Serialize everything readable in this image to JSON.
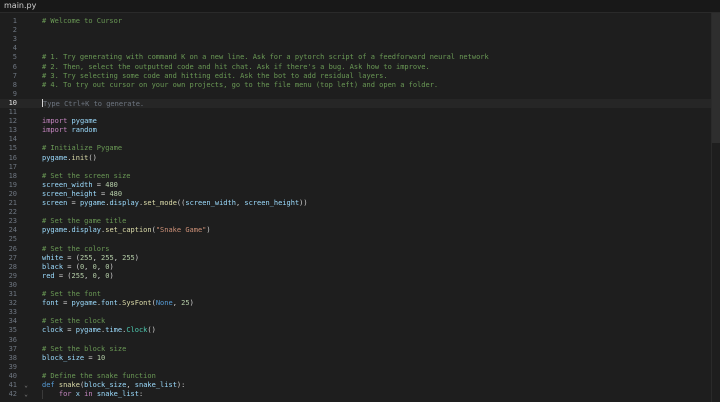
{
  "window": {
    "tab_title": "main.py"
  },
  "editor": {
    "current_line": 10,
    "lines": [
      {
        "n": "1",
        "tokens": [
          {
            "t": "# Welcome to Cursor",
            "c": "comment"
          }
        ]
      },
      {
        "n": "2",
        "tokens": []
      },
      {
        "n": "3",
        "tokens": []
      },
      {
        "n": "4",
        "tokens": []
      },
      {
        "n": "5",
        "tokens": [
          {
            "t": "# 1. Try generating with command K on a new line. Ask for a pytorch script of a feedforward neural network",
            "c": "comment"
          }
        ]
      },
      {
        "n": "6",
        "tokens": [
          {
            "t": "# 2. Then, select the outputted code and hit chat. Ask if there's a bug. Ask how to improve.",
            "c": "comment"
          }
        ]
      },
      {
        "n": "7",
        "tokens": [
          {
            "t": "# 3. Try selecting some code and hitting edit. Ask the bot to add residual layers.",
            "c": "comment"
          }
        ]
      },
      {
        "n": "8",
        "tokens": [
          {
            "t": "# 4. To try out cursor on your own projects, go to the file menu (top left) and open a folder.",
            "c": "comment"
          }
        ]
      },
      {
        "n": "9",
        "tokens": []
      },
      {
        "n": "10",
        "tokens": [
          {
            "t": "Type Ctrl+K to generate.",
            "c": "placeholder"
          }
        ],
        "cursor": true
      },
      {
        "n": "11",
        "tokens": []
      },
      {
        "n": "12",
        "tokens": [
          {
            "t": "import",
            "c": "keyword"
          },
          {
            "t": " ",
            "c": "plain"
          },
          {
            "t": "pygame",
            "c": "var"
          }
        ]
      },
      {
        "n": "13",
        "tokens": [
          {
            "t": "import",
            "c": "keyword"
          },
          {
            "t": " ",
            "c": "plain"
          },
          {
            "t": "random",
            "c": "var"
          }
        ]
      },
      {
        "n": "14",
        "tokens": []
      },
      {
        "n": "15",
        "tokens": [
          {
            "t": "# Initialize Pygame",
            "c": "comment"
          }
        ]
      },
      {
        "n": "16",
        "tokens": [
          {
            "t": "pygame",
            "c": "var"
          },
          {
            "t": ".",
            "c": "plain"
          },
          {
            "t": "init",
            "c": "func"
          },
          {
            "t": "()",
            "c": "paren"
          }
        ]
      },
      {
        "n": "17",
        "tokens": []
      },
      {
        "n": "18",
        "tokens": [
          {
            "t": "# Set the screen size",
            "c": "comment"
          }
        ]
      },
      {
        "n": "19",
        "tokens": [
          {
            "t": "screen_width",
            "c": "var"
          },
          {
            "t": " = ",
            "c": "plain"
          },
          {
            "t": "480",
            "c": "num"
          }
        ]
      },
      {
        "n": "20",
        "tokens": [
          {
            "t": "screen_height",
            "c": "var"
          },
          {
            "t": " = ",
            "c": "plain"
          },
          {
            "t": "480",
            "c": "num"
          }
        ]
      },
      {
        "n": "21",
        "tokens": [
          {
            "t": "screen",
            "c": "var"
          },
          {
            "t": " = ",
            "c": "plain"
          },
          {
            "t": "pygame",
            "c": "var"
          },
          {
            "t": ".",
            "c": "plain"
          },
          {
            "t": "display",
            "c": "var"
          },
          {
            "t": ".",
            "c": "plain"
          },
          {
            "t": "set_mode",
            "c": "func"
          },
          {
            "t": "((",
            "c": "paren"
          },
          {
            "t": "screen_width",
            "c": "var"
          },
          {
            "t": ", ",
            "c": "plain"
          },
          {
            "t": "screen_height",
            "c": "var"
          },
          {
            "t": "))",
            "c": "paren"
          }
        ]
      },
      {
        "n": "22",
        "tokens": []
      },
      {
        "n": "23",
        "tokens": [
          {
            "t": "# Set the game title",
            "c": "comment"
          }
        ]
      },
      {
        "n": "24",
        "tokens": [
          {
            "t": "pygame",
            "c": "var"
          },
          {
            "t": ".",
            "c": "plain"
          },
          {
            "t": "display",
            "c": "var"
          },
          {
            "t": ".",
            "c": "plain"
          },
          {
            "t": "set_caption",
            "c": "func"
          },
          {
            "t": "(",
            "c": "paren"
          },
          {
            "t": "\"Snake Game\"",
            "c": "str"
          },
          {
            "t": ")",
            "c": "paren"
          }
        ]
      },
      {
        "n": "25",
        "tokens": []
      },
      {
        "n": "26",
        "tokens": [
          {
            "t": "# Set the colors",
            "c": "comment"
          }
        ]
      },
      {
        "n": "27",
        "tokens": [
          {
            "t": "white",
            "c": "var"
          },
          {
            "t": " = (",
            "c": "plain"
          },
          {
            "t": "255",
            "c": "num"
          },
          {
            "t": ", ",
            "c": "plain"
          },
          {
            "t": "255",
            "c": "num"
          },
          {
            "t": ", ",
            "c": "plain"
          },
          {
            "t": "255",
            "c": "num"
          },
          {
            "t": ")",
            "c": "plain"
          }
        ]
      },
      {
        "n": "28",
        "tokens": [
          {
            "t": "black",
            "c": "var"
          },
          {
            "t": " = (",
            "c": "plain"
          },
          {
            "t": "0",
            "c": "num"
          },
          {
            "t": ", ",
            "c": "plain"
          },
          {
            "t": "0",
            "c": "num"
          },
          {
            "t": ", ",
            "c": "plain"
          },
          {
            "t": "0",
            "c": "num"
          },
          {
            "t": ")",
            "c": "plain"
          }
        ]
      },
      {
        "n": "29",
        "tokens": [
          {
            "t": "red",
            "c": "var"
          },
          {
            "t": " = (",
            "c": "plain"
          },
          {
            "t": "255",
            "c": "num"
          },
          {
            "t": ", ",
            "c": "plain"
          },
          {
            "t": "0",
            "c": "num"
          },
          {
            "t": ", ",
            "c": "plain"
          },
          {
            "t": "0",
            "c": "num"
          },
          {
            "t": ")",
            "c": "plain"
          }
        ]
      },
      {
        "n": "30",
        "tokens": []
      },
      {
        "n": "31",
        "tokens": [
          {
            "t": "# Set the font",
            "c": "comment"
          }
        ]
      },
      {
        "n": "32",
        "tokens": [
          {
            "t": "font",
            "c": "var"
          },
          {
            "t": " = ",
            "c": "plain"
          },
          {
            "t": "pygame",
            "c": "var"
          },
          {
            "t": ".",
            "c": "plain"
          },
          {
            "t": "font",
            "c": "var"
          },
          {
            "t": ".",
            "c": "plain"
          },
          {
            "t": "SysFont",
            "c": "func"
          },
          {
            "t": "(",
            "c": "paren"
          },
          {
            "t": "None",
            "c": "def"
          },
          {
            "t": ", ",
            "c": "plain"
          },
          {
            "t": "25",
            "c": "num"
          },
          {
            "t": ")",
            "c": "paren"
          }
        ]
      },
      {
        "n": "33",
        "tokens": []
      },
      {
        "n": "34",
        "tokens": [
          {
            "t": "# Set the clock",
            "c": "comment"
          }
        ]
      },
      {
        "n": "35",
        "tokens": [
          {
            "t": "clock",
            "c": "var"
          },
          {
            "t": " = ",
            "c": "plain"
          },
          {
            "t": "pygame",
            "c": "var"
          },
          {
            "t": ".",
            "c": "plain"
          },
          {
            "t": "time",
            "c": "var"
          },
          {
            "t": ".",
            "c": "plain"
          },
          {
            "t": "Clock",
            "c": "builtin"
          },
          {
            "t": "()",
            "c": "paren"
          }
        ]
      },
      {
        "n": "36",
        "tokens": []
      },
      {
        "n": "37",
        "tokens": [
          {
            "t": "# Set the block size",
            "c": "comment"
          }
        ]
      },
      {
        "n": "38",
        "tokens": [
          {
            "t": "block_size",
            "c": "var"
          },
          {
            "t": " = ",
            "c": "plain"
          },
          {
            "t": "10",
            "c": "num"
          }
        ]
      },
      {
        "n": "39",
        "tokens": []
      },
      {
        "n": "40",
        "tokens": [
          {
            "t": "# Define the snake function",
            "c": "comment"
          }
        ]
      },
      {
        "n": "41",
        "tokens": [
          {
            "t": "def",
            "c": "def"
          },
          {
            "t": " ",
            "c": "plain"
          },
          {
            "t": "snake",
            "c": "func"
          },
          {
            "t": "(",
            "c": "paren"
          },
          {
            "t": "block_size",
            "c": "var"
          },
          {
            "t": ", ",
            "c": "plain"
          },
          {
            "t": "snake_list",
            "c": "var"
          },
          {
            "t": "):",
            "c": "paren"
          }
        ],
        "fold": "⌄"
      },
      {
        "n": "42",
        "tokens": [
          {
            "t": "    ",
            "c": "plain"
          },
          {
            "t": "for",
            "c": "keyword"
          },
          {
            "t": " ",
            "c": "plain"
          },
          {
            "t": "x",
            "c": "var"
          },
          {
            "t": " ",
            "c": "plain"
          },
          {
            "t": "in",
            "c": "keyword"
          },
          {
            "t": " ",
            "c": "plain"
          },
          {
            "t": "snake_list",
            "c": "var"
          },
          {
            "t": ":",
            "c": "plain"
          }
        ],
        "fold": "⌄",
        "indent": true
      }
    ]
  }
}
